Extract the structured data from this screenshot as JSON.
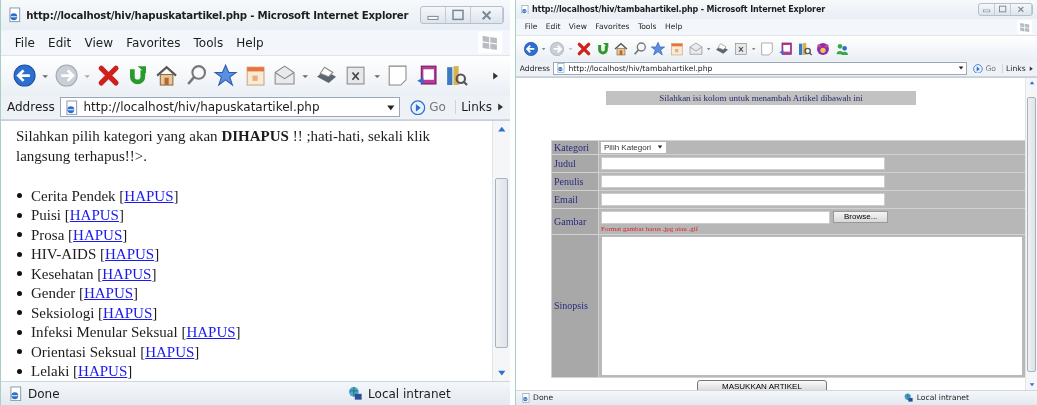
{
  "windows": [
    {
      "title": "http://localhost/hiv/hapuskatartikel.php - Microsoft Internet Explorer",
      "menu": [
        "File",
        "Edit",
        "View",
        "Favorites",
        "Tools",
        "Help"
      ],
      "address_label": "Address",
      "url": "http://localhost/hiv/hapuskatartikel.php",
      "go": "Go",
      "links": "Links",
      "page": {
        "kind": "delete_list",
        "intro": "Silahkan pilih kategori yang akan **DIHAPUS** !! ;hati-hati, sekali klik langsung terhapus!!>.",
        "items": [
          {
            "label": "Cerita Pendek [",
            "link": "HAPUS",
            "after": "]"
          },
          {
            "label": "Puisi [",
            "link": "HAPUS",
            "after": "]"
          },
          {
            "label": "Prosa [",
            "link": "HAPUS",
            "after": "]"
          },
          {
            "label": "HIV-AIDS [",
            "link": "HAPUS",
            "after": "]"
          },
          {
            "label": "Kesehatan [",
            "link": "HAPUS",
            "after": "]"
          },
          {
            "label": "Gender [",
            "link": "HAPUS",
            "after": "]"
          },
          {
            "label": "Seksiologi [",
            "link": "HAPUS",
            "after": "]"
          },
          {
            "label": "Infeksi Menular Seksual [",
            "link": "HAPUS",
            "after": "]"
          },
          {
            "label": "Orientasi Seksual [",
            "link": "HAPUS",
            "after": "]"
          },
          {
            "label": "Lelaki [",
            "link": "HAPUS",
            "after": "]"
          }
        ]
      },
      "status": {
        "text": "Done",
        "zone": "Local intranet"
      }
    },
    {
      "title": "http://localhost/hiv/tambahartikel.php - Microsoft Internet Explorer",
      "menu": [
        "File",
        "Edit",
        "View",
        "Favorites",
        "Tools",
        "Help"
      ],
      "address_label": "Address",
      "url": "http://localhost/hiv/tambahartikel.php",
      "go": "Go",
      "links": "Links",
      "page": {
        "kind": "article_form",
        "banner": "Silahkan isi kolom untuk menambah Artikel dibawah ini",
        "fields": [
          {
            "label": "Kategori",
            "kind": "select",
            "value": "Pilih Kategori"
          },
          {
            "label": "Judul",
            "kind": "text"
          },
          {
            "label": "Penulis",
            "kind": "text"
          },
          {
            "label": "Email",
            "kind": "text"
          },
          {
            "label": "Gambar",
            "kind": "file",
            "button": "Browse...",
            "hint": "Format gambar harus .jpg atau .gif"
          },
          {
            "label": "Sinopsis",
            "kind": "textarea"
          }
        ],
        "submit": "MASUKKAN ARTIKEL"
      },
      "status": {
        "text": "Done",
        "zone": "Local intranet"
      }
    }
  ]
}
